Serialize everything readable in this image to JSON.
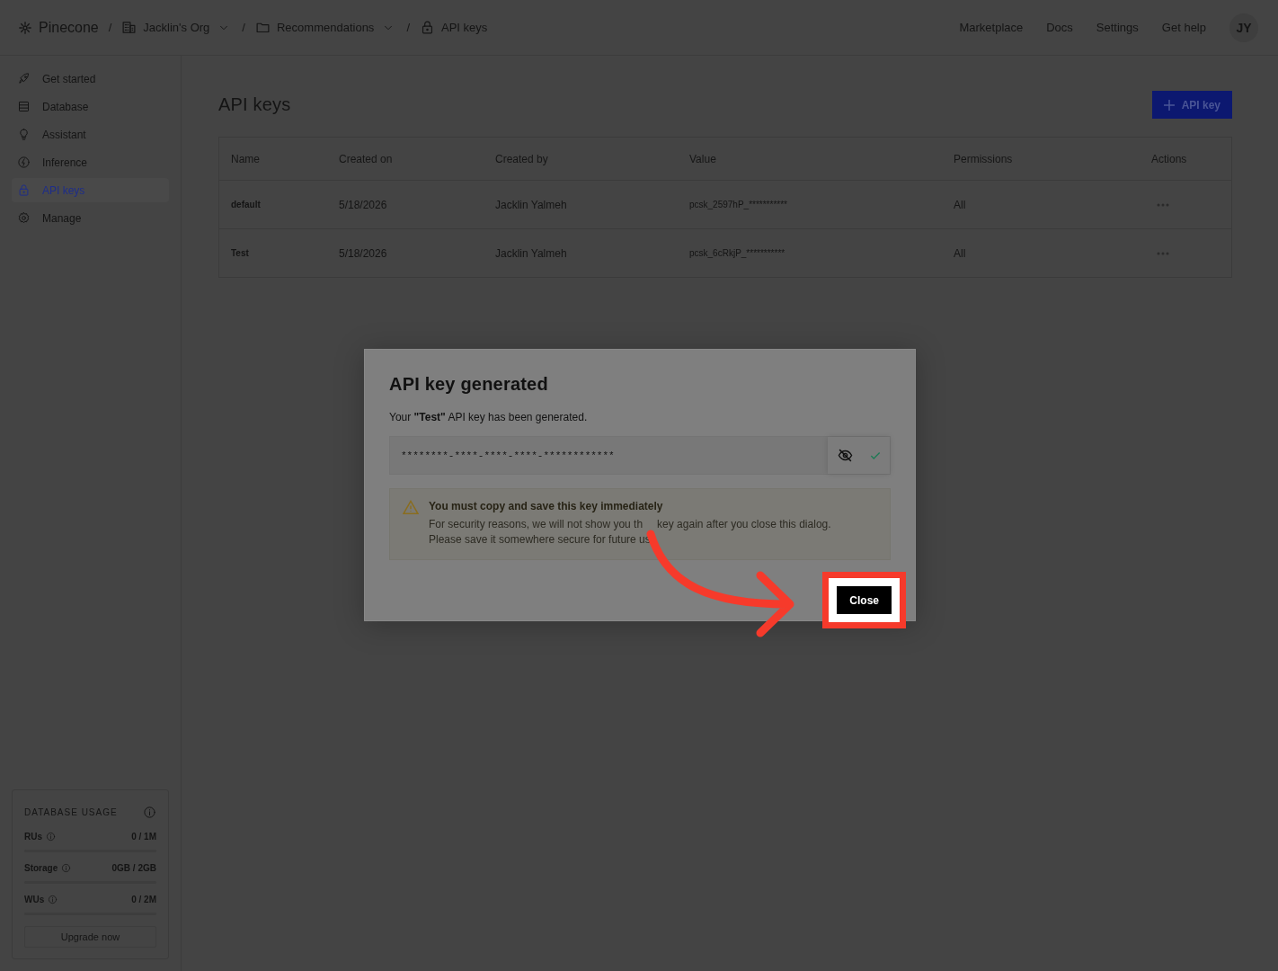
{
  "topbar": {
    "logo": "Pinecone",
    "separator": "/",
    "breadcrumbs": [
      {
        "kind": "org",
        "label": "Jacklin's Org",
        "dropdown": true
      },
      {
        "kind": "project",
        "label": "Recommendations",
        "dropdown": true
      },
      {
        "kind": "page",
        "label": "API keys",
        "dropdown": false
      }
    ],
    "links": [
      "Marketplace",
      "Docs",
      "Settings",
      "Get help"
    ],
    "avatar": "JY"
  },
  "sidebar": {
    "items": [
      {
        "label": "Get started",
        "selected": false
      },
      {
        "label": "Database",
        "selected": false
      },
      {
        "label": "Assistant",
        "selected": false
      },
      {
        "label": "Inference",
        "selected": false
      },
      {
        "label": "API keys",
        "selected": true
      },
      {
        "label": "Manage",
        "selected": false
      }
    ],
    "usage": {
      "title": "DATABASE USAGE",
      "meters": [
        {
          "label": "RUs",
          "reading": "0 / 1M",
          "level": 0
        },
        {
          "label": "Storage",
          "reading": "0GB / 2GB",
          "level": 0
        },
        {
          "label": "WUs",
          "reading": "0 / 2M",
          "level": 0
        }
      ],
      "button": "Upgrade now"
    }
  },
  "page": {
    "title": "API keys",
    "add_button": "API key",
    "table": {
      "columns": [
        "Name",
        "Created on",
        "Created by",
        "Value",
        "Permissions",
        "Actions"
      ],
      "rows": [
        {
          "name": "default",
          "created_on": "5/18/2026",
          "created_by": "Jacklin Yalmeh",
          "value": "pcsk_2597hP_***********",
          "permissions": "All"
        },
        {
          "name": "Test",
          "created_on": "5/18/2026",
          "created_by": "Jacklin Yalmeh",
          "value": "pcsk_6cRkjP_***********",
          "permissions": "All"
        }
      ]
    }
  },
  "dialog": {
    "title": "API key generated",
    "message": "Your **\"Test\"** API key has been generated.",
    "key_value": "********-****-****-****-************",
    "copied": true,
    "warning": {
      "title": "You must copy and save this key immediately",
      "lines": [
        [
          "For security reasons, we will not show you th",
          "key again after you close this dialog."
        ],
        [
          "Please save it somewhere secure for future us"
        ]
      ]
    },
    "close_button": {
      "label": "Close",
      "highlighted": true
    }
  }
}
